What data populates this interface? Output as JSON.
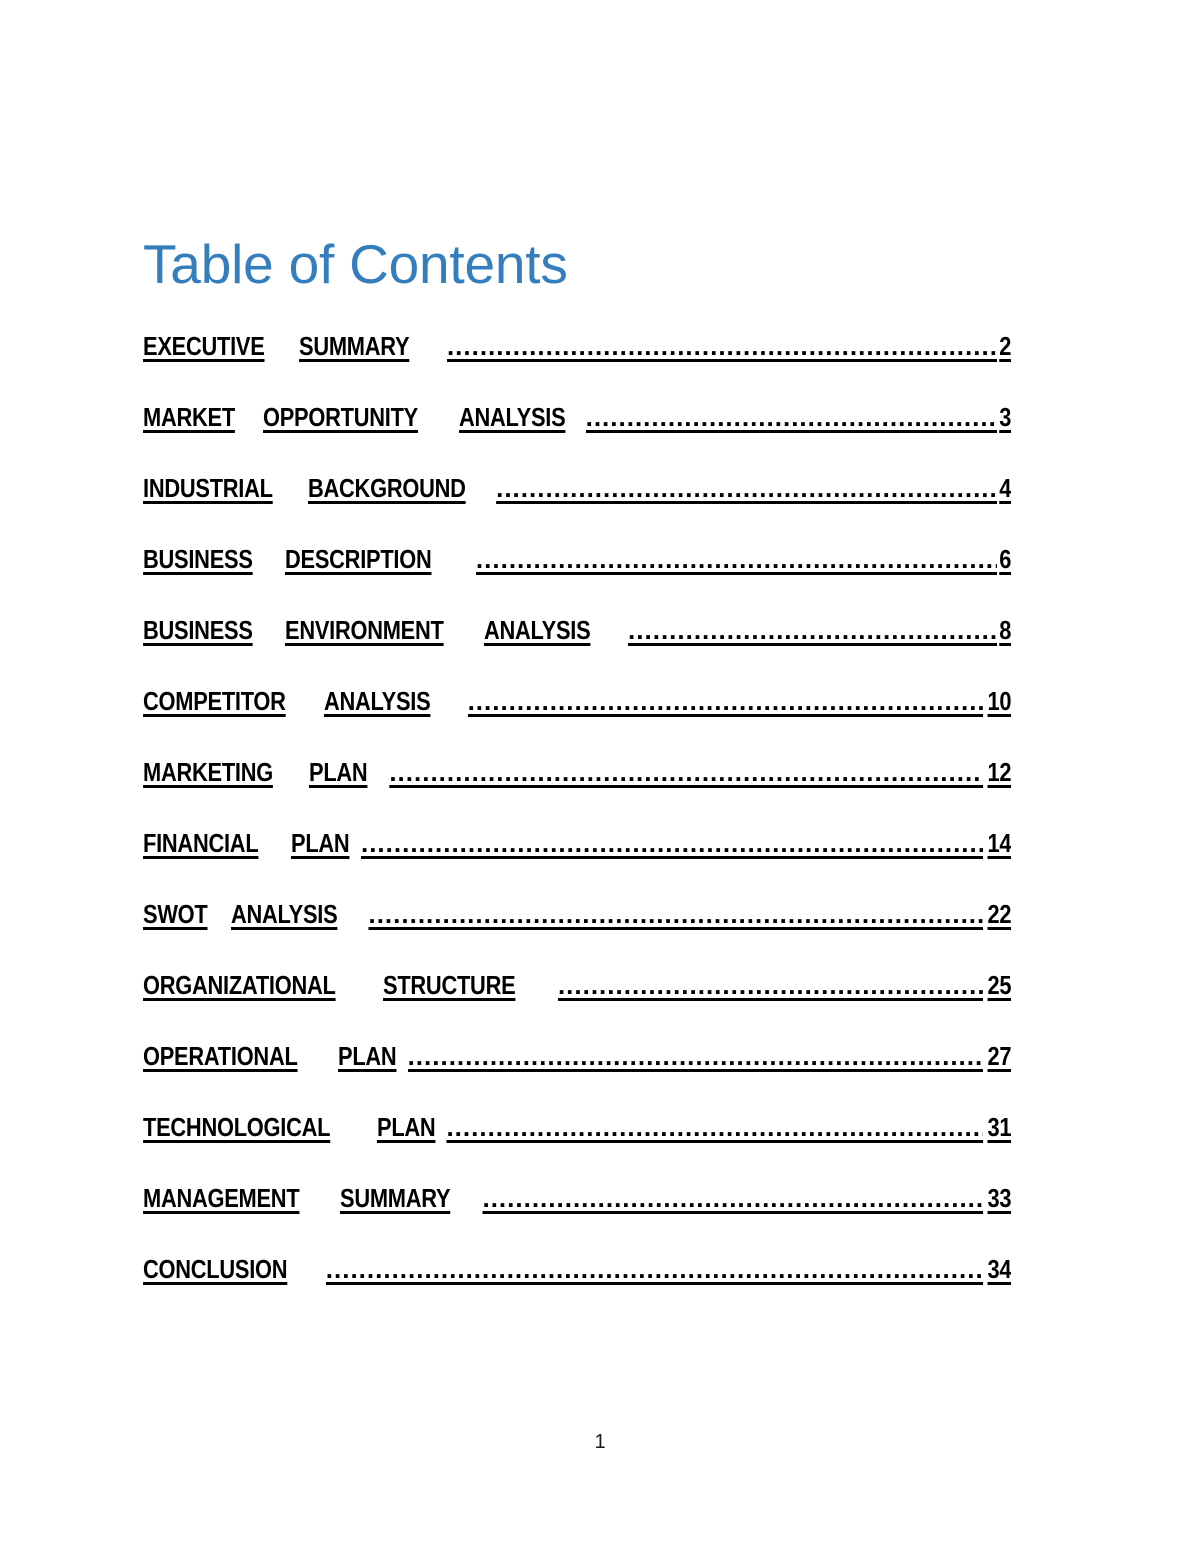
{
  "document": {
    "title": "Table of Contents",
    "title_color": "#357EBD",
    "page_background": "#ffffff",
    "text_color": "#000000",
    "footer_page_number": "1"
  },
  "toc": {
    "leader_character": ".",
    "entries": [
      {
        "words": [
          "EXECUTIVE",
          "SUMMARY"
        ],
        "gap_before_dots": "wide",
        "page": "2"
      },
      {
        "words": [
          "MARKET",
          "OPPORTUNITY",
          "ANALYSIS"
        ],
        "gap_before_dots": "tight",
        "page": "3"
      },
      {
        "words": [
          "INDUSTRIAL",
          "BACKGROUND"
        ],
        "gap_before_dots": "tight",
        "page": "4"
      },
      {
        "words": [
          "BUSINESS",
          "DESCRIPTION"
        ],
        "gap_before_dots": "wide",
        "page": "6"
      },
      {
        "words": [
          "BUSINESS",
          "ENVIRONMENT",
          "ANALYSIS"
        ],
        "gap_before_dots": "wide",
        "page": "8"
      },
      {
        "words": [
          "COMPETITOR",
          "ANALYSIS"
        ],
        "gap_before_dots": "wide",
        "page": "10"
      },
      {
        "words": [
          "MARKETING",
          "PLAN"
        ],
        "gap_before_dots": "normal",
        "page": "12"
      },
      {
        "words": [
          "FINANCIAL",
          "PLAN"
        ],
        "gap_before_dots": "tight",
        "page": "14"
      },
      {
        "words": [
          "SWOT",
          "ANALYSIS"
        ],
        "gap_before_dots": "normal",
        "page": "22"
      },
      {
        "words": [
          "ORGANIZATIONAL",
          "STRUCTURE"
        ],
        "gap_before_dots": "wide",
        "page": "25"
      },
      {
        "words": [
          "OPERATIONAL",
          "PLAN"
        ],
        "gap_before_dots": "tight",
        "page": "27"
      },
      {
        "words": [
          "TECHNOLOGICAL",
          "PLAN"
        ],
        "gap_before_dots": "tight",
        "page": "31"
      },
      {
        "words": [
          "MANAGEMENT",
          "SUMMARY"
        ],
        "gap_before_dots": "normal",
        "page": "33"
      },
      {
        "words": [
          "CONCLUSION"
        ],
        "gap_before_dots": "normal",
        "page": "34"
      }
    ]
  }
}
